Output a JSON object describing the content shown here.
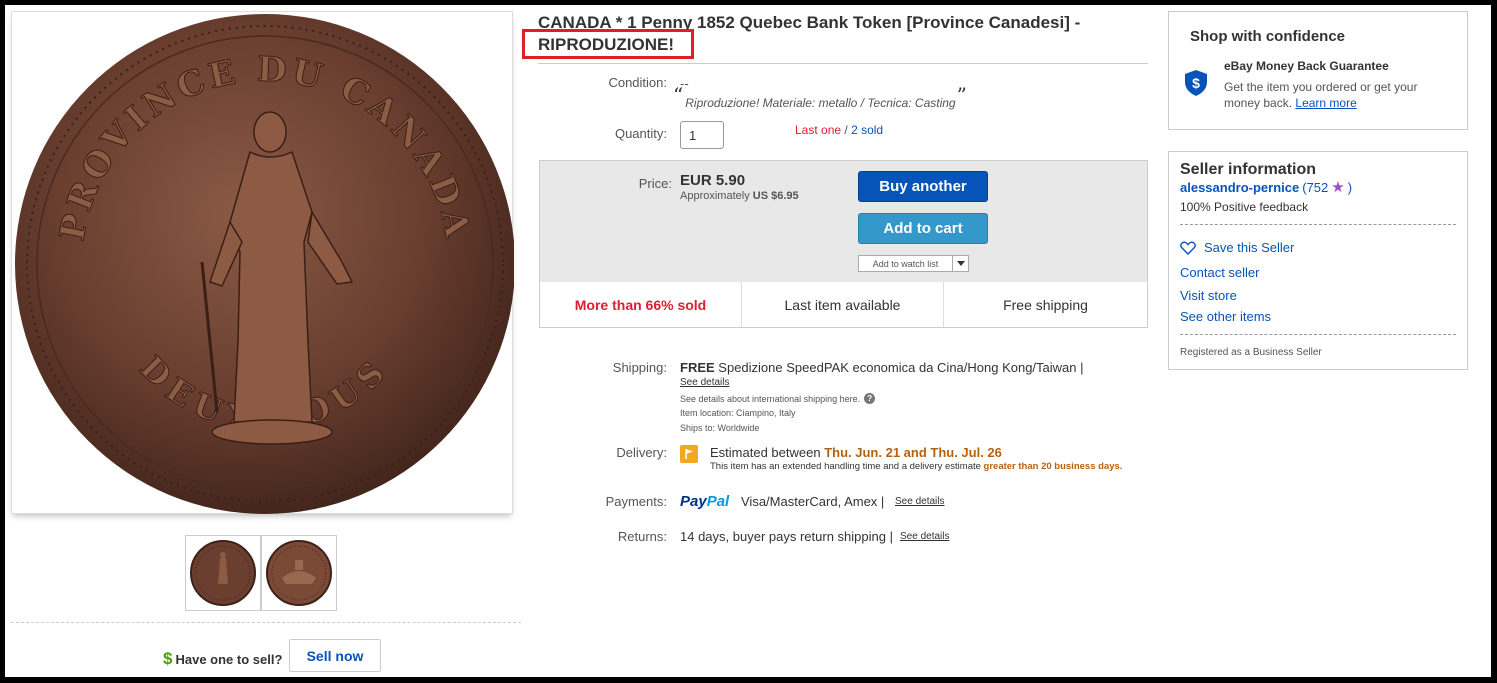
{
  "listing": {
    "title_main": "CANADA * 1 Penny 1852 Quebec Bank Token [Province Canadesi] -",
    "title_highlight": "RIPRODUZIONE!"
  },
  "images": {
    "main_coin_text_top": "PROVINCE DU CANADA",
    "main_coin_text_bottom": "DEUX SOUS",
    "thumbnails": [
      "coin-front-thumbnail",
      "coin-back-thumbnail"
    ]
  },
  "sell": {
    "dollar_icon": "$",
    "prompt": "Have one to sell?",
    "button_label": "Sell now"
  },
  "condition": {
    "label": "Condition:",
    "value": "--",
    "open_quote": "“",
    "description": "Riproduzione! Materiale: metallo / Tecnica: Casting",
    "close_quote": "”"
  },
  "quantity": {
    "label": "Quantity:",
    "value": "1",
    "last_one": "Last one",
    "separator": " / ",
    "sold": "2 sold"
  },
  "price": {
    "label": "Price:",
    "value": "EUR 5.90",
    "approx_prefix": "Approximately",
    "approx_value": "US $6.95",
    "buy_another": "Buy another",
    "add_to_cart": "Add to cart",
    "watch_list": "Add to watch list"
  },
  "features": [
    "More than 66% sold",
    "Last item available",
    "Free shipping"
  ],
  "shipping": {
    "label": "Shipping:",
    "free": "FREE",
    "service": "Spedizione SpeedPAK economica da Cina/Hong Kong/Taiwan |",
    "details_link": "See details",
    "intl_note": "See details about international shipping here.",
    "help_glyph": "?",
    "item_location": "Item location:  Ciampino, Italy",
    "ships_to": "Ships to:  Worldwide"
  },
  "delivery": {
    "label": "Delivery:",
    "estimated_prefix": "Estimated between",
    "dates": "Thu. Jun. 21 and Thu. Jul. 26",
    "note_prefix": "This item has an extended handling time and a delivery estimate",
    "note_highlight": "greater than 20 business days."
  },
  "payments": {
    "label": "Payments:",
    "paypal_pay": "Pay",
    "paypal_pal": "Pal",
    "methods": "Visa/MasterCard, Amex  |",
    "details_link": "See details"
  },
  "returns": {
    "label": "Returns:",
    "text": "14 days, buyer pays return shipping |",
    "details_link": "See details"
  },
  "confidence": {
    "title": "Shop with confidence",
    "guarantee_title": "eBay Money Back Guarantee",
    "guarantee_text": "Get the item you ordered or get your money back.",
    "learn_more": "Learn more"
  },
  "seller": {
    "title": "Seller information",
    "name": "alessandro-pernice",
    "feedback_open": "(752",
    "feedback_close": ")",
    "positive": "100% Positive feedback",
    "save": "Save this Seller",
    "contact": "Contact seller",
    "visit_store": "Visit store",
    "other_items": "See other items",
    "registered": "Registered as a Business Seller"
  },
  "colors": {
    "link": "#0654ba",
    "buy_button": "#0654ba",
    "cart_button": "#3498ca",
    "alert_red": "#dd1e31",
    "highlight_box": "#e01e26",
    "delivery_orange": "#b8610f"
  }
}
